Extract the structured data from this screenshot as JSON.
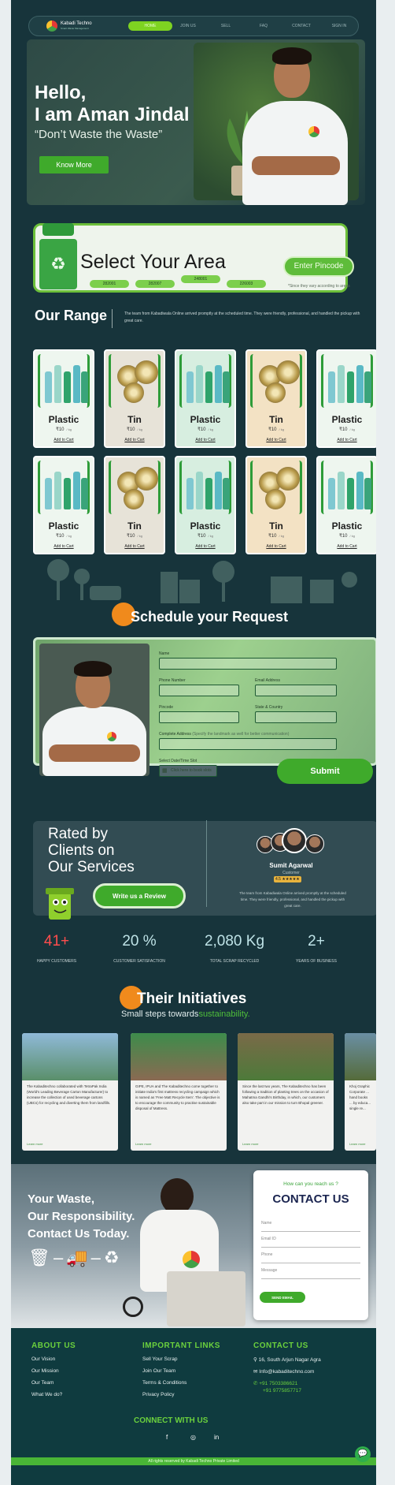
{
  "nav": {
    "brand": "Kabadi Techno",
    "brand_tagline": "Smart Waste Management",
    "links": [
      "HOME",
      "JOIN US",
      "SELL",
      "FAQ",
      "CONTACT",
      "SIGN IN"
    ]
  },
  "hero": {
    "greeting": "Hello,",
    "name_line": "I am Aman Jindal",
    "tagline": "“Don’t Waste the Waste”",
    "cta": "Know More"
  },
  "area": {
    "title": "Select Your Area",
    "pincode_button": "Enter Pincode",
    "pincodes": [
      "282001",
      "282007",
      "248001",
      "226003"
    ],
    "note": "*Since they vary according to areas"
  },
  "range": {
    "title": "Our Range",
    "description": "The team from Kabadiwala Online arrived promptly at the scheduled time. They were friendly, professional, and handled the pickup with great care.",
    "products": [
      {
        "name": "Plastic",
        "price": "₹10",
        "unit": "/ kg",
        "cart": "Add to Cart",
        "kind": "plastic",
        "tint": false
      },
      {
        "name": "Tin",
        "price": "₹10",
        "unit": "/ kg",
        "cart": "Add to Cart",
        "kind": "tin",
        "tint": false
      },
      {
        "name": "Plastic",
        "price": "₹10",
        "unit": "/ kg",
        "cart": "Add to Cart",
        "kind": "plastic",
        "tint": true
      },
      {
        "name": "Tin",
        "price": "₹10",
        "unit": "/ kg",
        "cart": "Add to Cart",
        "kind": "tin",
        "tint": true
      },
      {
        "name": "Plastic",
        "price": "₹10",
        "unit": "/ kg",
        "cart": "Add to Cart",
        "kind": "plastic",
        "tint": false
      },
      {
        "name": "Plastic",
        "price": "₹10",
        "unit": "/ kg",
        "cart": "Add to Cart",
        "kind": "plastic",
        "tint": false
      },
      {
        "name": "Tin",
        "price": "₹10",
        "unit": "/ kg",
        "cart": "Add to Cart",
        "kind": "tin",
        "tint": false
      },
      {
        "name": "Plastic",
        "price": "₹10",
        "unit": "/ kg",
        "cart": "Add to Cart",
        "kind": "plastic",
        "tint": true
      },
      {
        "name": "Tin",
        "price": "₹10",
        "unit": "/ kg",
        "cart": "Add to Cart",
        "kind": "tin",
        "tint": true
      },
      {
        "name": "Plastic",
        "price": "₹10",
        "unit": "/ kg",
        "cart": "Add to Cart",
        "kind": "plastic",
        "tint": false
      }
    ]
  },
  "schedule": {
    "title": "Schedule your Request",
    "labels": {
      "name": "Name",
      "phone": "Phone Number",
      "email": "Email Address",
      "pincode": "Pincode",
      "state": "State & Country",
      "address": "Complete Address",
      "address_hint": "(Specify the landmark as well for better communication)",
      "datetime": "Select Date/Time Slot"
    },
    "slot_placeholder": "Click here to book slots",
    "submit": "Submit"
  },
  "rated": {
    "line1": "Rated by",
    "line2": "Clients on",
    "line3": "Our Services",
    "review_button": "Write us a Review",
    "reviewer_name": "Sumit Agarwal",
    "reviewer_role": "Customer",
    "rating_badge": "4.5 ★★★★★",
    "review_text": "The team from Kabadiwala Online arrived promptly at the scheduled time. They were friendly, professional, and handled the pickup with great care."
  },
  "stats": [
    {
      "value": "41+",
      "label": "HAPPY CUSTOMERS",
      "color": "#ff4d4d"
    },
    {
      "value": "20 %",
      "label": "CUSTOMER SATISFACTION",
      "color": "#bfe3e7"
    },
    {
      "value": "2,080 Kg",
      "label": "TOTAL SCRAP RECYCLED",
      "color": "#bfe3e7"
    },
    {
      "value": "2+",
      "label": "YEARS OF BUSINESS",
      "color": "#bfe3e7"
    }
  ],
  "initiatives": {
    "title": "Their Initiatives",
    "subtitle_plain": "Small steps towards",
    "subtitle_highlight": "sustainability.",
    "cards": [
      {
        "text": "The Kabaditechno collaborated with TetraPak India (World's Leading Beverage Carton Manufacturer) to increase the collection of used beverage cartons (UBCs) for recycling and diverting them from landfills.",
        "more": "Learn more"
      },
      {
        "text": "GIPE, IPUA and The Kabaditechno come together to initiate India's first mattress recycling campaign which is named as 'Free Matt Recycle Item'. The objective is to encourage the community to practise sustainable disposal of Mattress.",
        "more": "Learn more"
      },
      {
        "text": "Since the last two years, The Kabaditechno has been following a tradition of planting trees on the occasion of Mahatma Gandhi's Birthday, in which, our customers also take part in our mission to turn Bhopal greener.",
        "more": "Learn more"
      },
      {
        "text": "Khoj Graphic Corporate ... hand books ... by educa... single re...",
        "more": "Learn more"
      }
    ]
  },
  "contact": {
    "line1": "Your Waste,",
    "line2": "Our Responsibility.",
    "line3": "Contact Us Today.",
    "form_question": "How can you reach us ?",
    "form_title": "CONTACT US",
    "fields": [
      "Name",
      "Email ID",
      "Phone",
      "Message"
    ],
    "send": "SEND EMAIL"
  },
  "footer": {
    "about_head": "ABOUT US",
    "about_items": [
      "Our Vision",
      "Our Mission",
      "Our Team",
      "What We do?"
    ],
    "links_head": "IMPORTANT LINKS",
    "links_items": [
      "Sell Your Scrap",
      "Join Our Team",
      "Terms & Conditions",
      "Privacy Policy"
    ],
    "contact_head": "CONTACT US",
    "address": "16, South Arjun Nagar Agra",
    "email": "Info@kabaditechno.com",
    "phone1": "+91 7503386621",
    "phone2": "+91 9775857717",
    "connect": "CONNECT WITH US",
    "copyright": "All rights reserved by Kabadi Techno Private Limited"
  }
}
